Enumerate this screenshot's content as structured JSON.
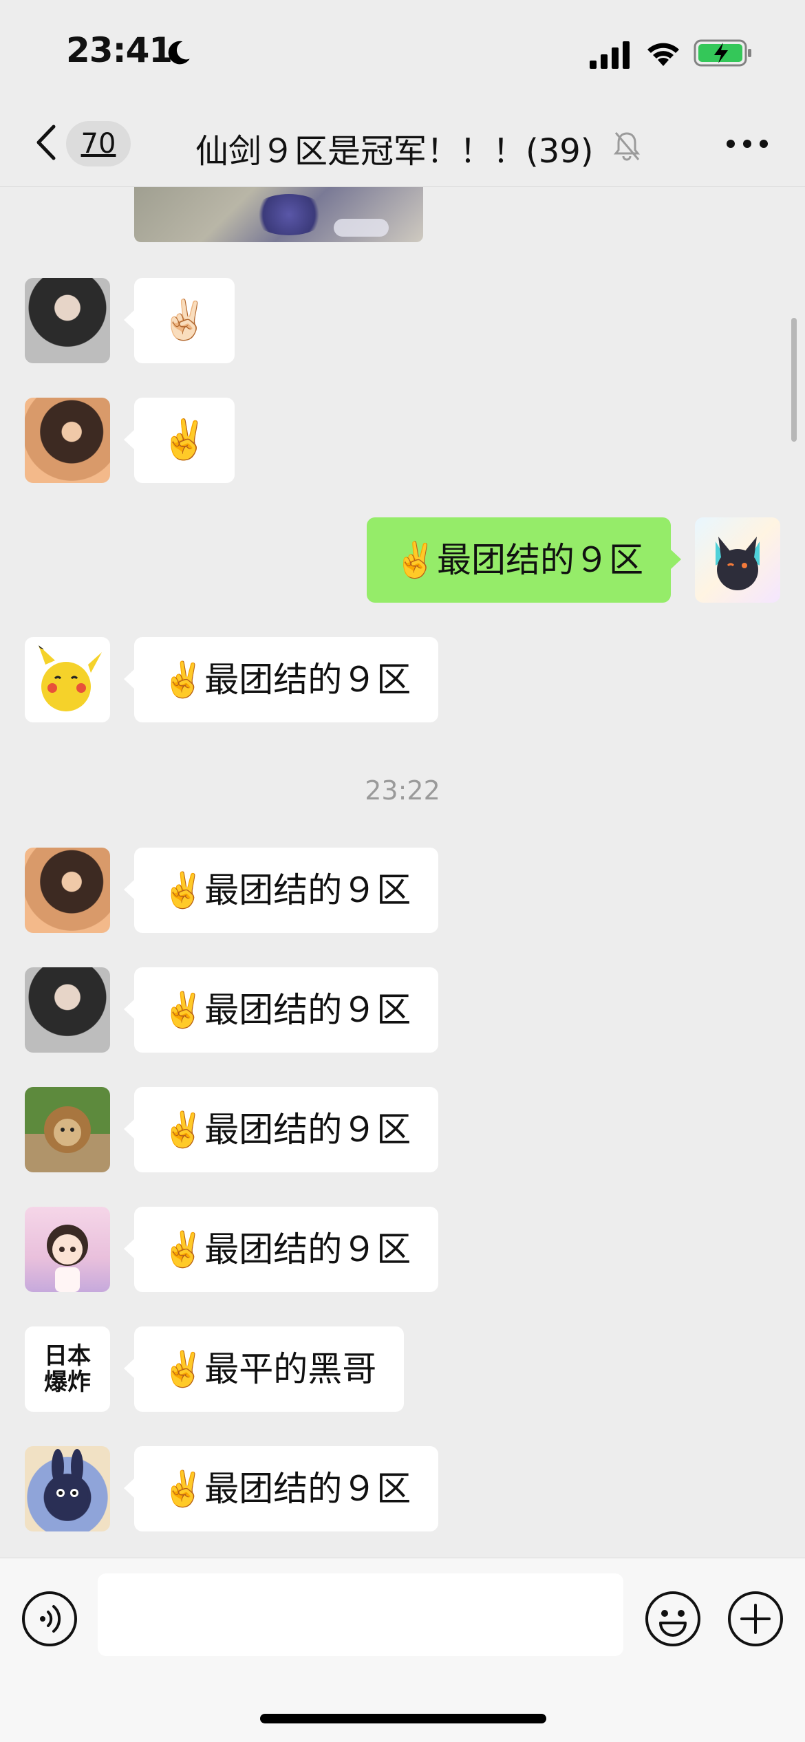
{
  "status_bar": {
    "time": "23:41",
    "icons": [
      "moon-icon",
      "signal-icon",
      "wifi-icon",
      "battery-charging-icon"
    ]
  },
  "nav": {
    "back_icon": "chevron-left-icon",
    "unread_count": "70",
    "title": "仙剑９区是冠军！！！(39)",
    "mute_icon": "bell-off-icon",
    "more_icon": "ellipsis-icon"
  },
  "chat": {
    "messages": [
      {
        "side": "left",
        "avatar": "avatar-dark-hair-girl",
        "text": "✌🏻"
      },
      {
        "side": "left",
        "avatar": "avatar-warm-photo-girl",
        "text": "✌️"
      },
      {
        "side": "right",
        "avatar": "avatar-cartoon-cat",
        "text": "✌️最团结的９区"
      },
      {
        "side": "left",
        "avatar": "avatar-pikachu",
        "text": "✌️最团结的９区"
      },
      {
        "type": "time",
        "text": "23:22"
      },
      {
        "side": "left",
        "avatar": "avatar-warm-photo-girl",
        "text": "✌️最团结的９区"
      },
      {
        "side": "left",
        "avatar": "avatar-dark-hair-girl",
        "text": "✌️最团结的９区"
      },
      {
        "side": "left",
        "avatar": "avatar-lion",
        "text": "✌️最团结的９区"
      },
      {
        "side": "left",
        "avatar": "avatar-anime-girl",
        "text": "✌️最团结的９区"
      },
      {
        "side": "left",
        "avatar": "avatar-text",
        "avatar_text": "日本\n爆炸",
        "text": "✌️最平的黑哥"
      },
      {
        "side": "left",
        "avatar": "avatar-rabbit",
        "text": "✌️最团结的９区"
      }
    ]
  },
  "input_bar": {
    "voice_icon": "voice-icon",
    "input_value": "",
    "emoji_icon": "smiley-icon",
    "plus_icon": "plus-icon"
  },
  "colors": {
    "background": "#ededed",
    "bubble_left": "#ffffff",
    "bubble_right": "#95ec69",
    "timestamp": "#9a9a9a",
    "battery_green": "#34c759"
  }
}
